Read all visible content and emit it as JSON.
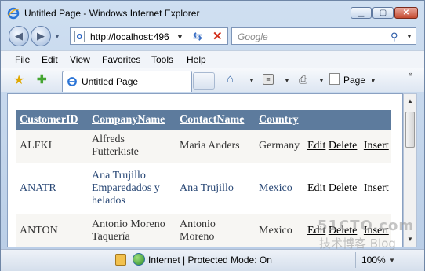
{
  "window": {
    "title": "Untitled Page - Windows Internet Explorer"
  },
  "nav": {
    "address": "http://localhost:496",
    "search_placeholder": "Google"
  },
  "menu": [
    "File",
    "Edit",
    "View",
    "Favorites",
    "Tools",
    "Help"
  ],
  "tab": {
    "label": "Untitled Page"
  },
  "command": {
    "page_label": "Page"
  },
  "grid": {
    "headers": [
      "CustomerID",
      "CompanyName",
      "ContactName",
      "Country"
    ],
    "rows": [
      {
        "id": "ALFKI",
        "company": "Alfreds Futterkiste",
        "contact": "Maria Anders",
        "country": "Germany"
      },
      {
        "id": "ANATR",
        "company": "Ana Trujillo Emparedados y helados",
        "contact": "Ana Trujillo",
        "country": "Mexico"
      },
      {
        "id": "ANTON",
        "company": "Antonio Moreno Taquería",
        "contact": "Antonio Moreno",
        "country": "Mexico"
      }
    ],
    "actions": {
      "edit": "Edit",
      "delete": "Delete",
      "insert": "Insert"
    }
  },
  "status": {
    "zone": "Internet | Protected Mode: On",
    "zoom": "100%"
  },
  "watermark": {
    "line1": "51CTO.com",
    "line2": "技术博客  Blog"
  },
  "icons": [
    "ie-logo-icon",
    "back-icon",
    "forward-icon",
    "page-icon",
    "refresh-icon",
    "stop-icon",
    "search-icon",
    "favorites-star-icon",
    "add-favorites-icon",
    "home-icon",
    "feeds-icon",
    "print-icon",
    "lock-icon",
    "globe-icon"
  ],
  "colors": {
    "grid_header": "#5d7b9d",
    "alt_row": "#f7f6f3",
    "link_text": "#284775"
  }
}
